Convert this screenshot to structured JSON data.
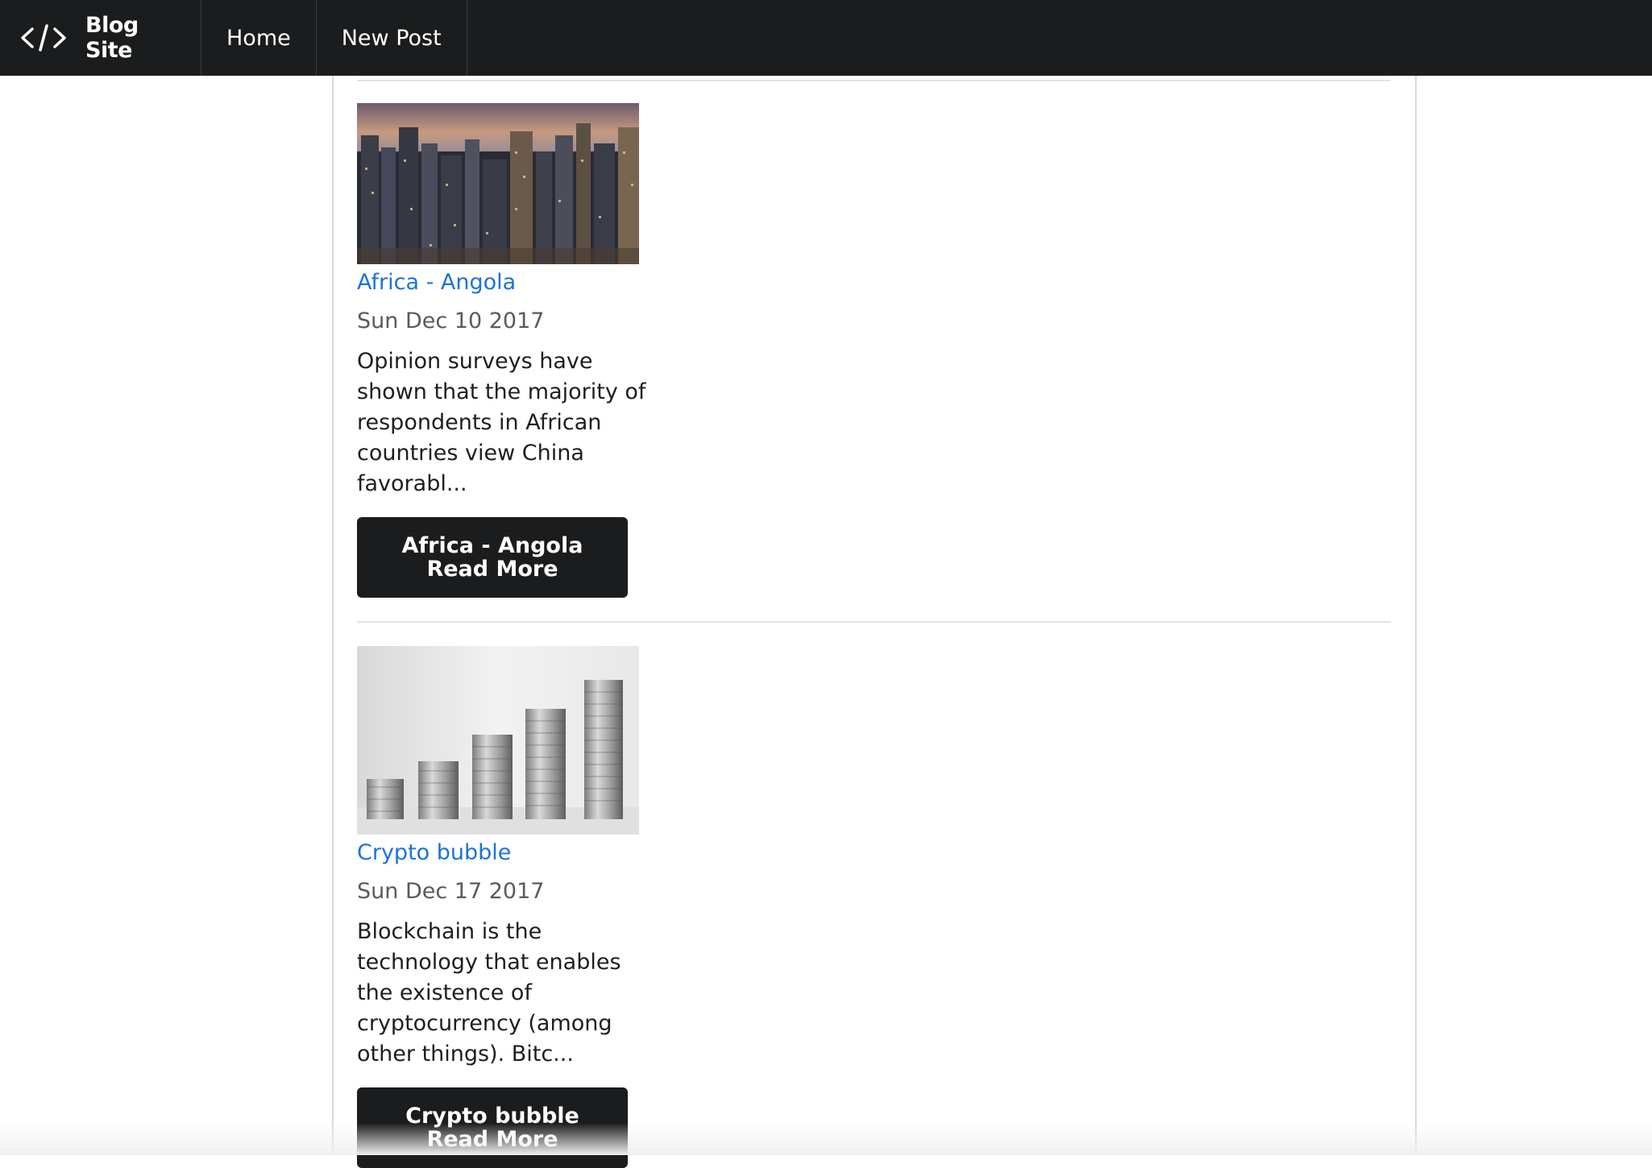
{
  "navbar": {
    "brand_icon": "code-icon",
    "brand_name": "Blog Site",
    "items": [
      {
        "label": "Home"
      },
      {
        "label": "New Post"
      }
    ]
  },
  "posts": [
    {
      "image": "city-skyline-photo",
      "title": "Africa - Angola",
      "date": "Sun Dec 10 2017",
      "excerpt": "Opinion surveys have shown that the majority of respondents in African countries view China favorabl...",
      "button_label": "Africa - Angola Read More"
    },
    {
      "image": "coin-stacks-photo",
      "title": "Crypto bubble",
      "date": "Sun Dec 17 2017",
      "excerpt": "Blockchain is the technology that enables the existence of cryptocurrency (among other things). Bitc...",
      "button_label": "Crypto bubble Read More"
    }
  ],
  "colors": {
    "navbar_bg": "#1b1c1d",
    "link": "#1a73d9",
    "button_bg": "#1b1c1d"
  }
}
